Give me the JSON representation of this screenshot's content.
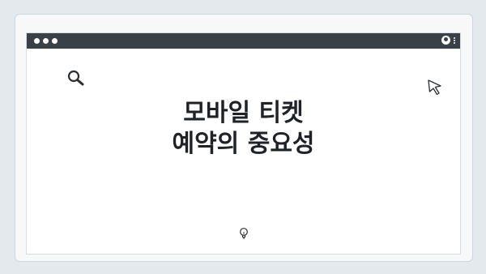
{
  "window": {
    "title_lines": [
      "모바일 티켓",
      "예약의 중요성"
    ]
  },
  "icons": {
    "search": "search-icon",
    "cursor": "cursor-arrow-icon",
    "bulb": "lightbulb-icon",
    "user": "user-icon",
    "menu": "kebab-menu-icon"
  },
  "colors": {
    "background": "#e4e9ee",
    "titlebar": "#3b4046",
    "text": "#1f2327"
  }
}
